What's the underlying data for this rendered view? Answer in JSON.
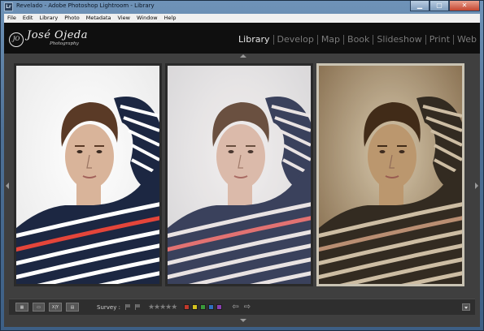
{
  "window": {
    "title": "Revelado - Adobe Photoshop Lightroom - Library",
    "app_icon": "Lr"
  },
  "menu": [
    "File",
    "Edit",
    "Library",
    "Photo",
    "Metadata",
    "View",
    "Window",
    "Help"
  ],
  "identity_plate": {
    "name": "José Ojeda",
    "subtitle": "Photography",
    "badge": "JO"
  },
  "modules": [
    "Library",
    "Develop",
    "Map",
    "Book",
    "Slideshow",
    "Print",
    "Web"
  ],
  "active_module": "Library",
  "photos": [
    {
      "tone": "original",
      "selected": false
    },
    {
      "tone": "soft",
      "selected": false
    },
    {
      "tone": "sepia",
      "selected": true
    }
  ],
  "toolbar": {
    "compare_label": "X|Y",
    "survey_label": "Survey :",
    "stars": "★★★★★",
    "color_labels": [
      "#c0392b",
      "#d4c21f",
      "#3a9a3a",
      "#2f6fbf",
      "#8a3fb0"
    ]
  }
}
